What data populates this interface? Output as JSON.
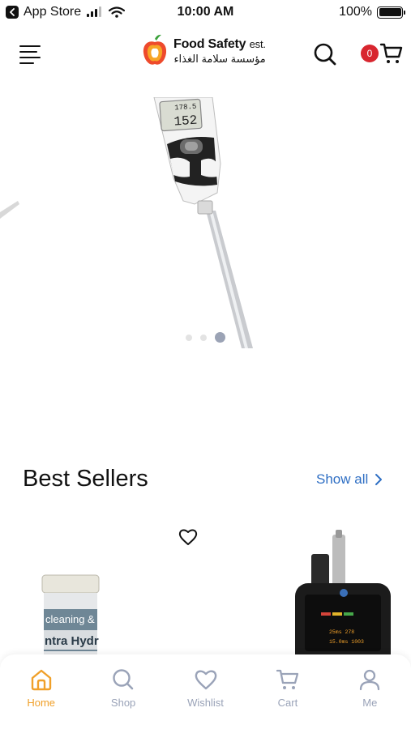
{
  "status_bar": {
    "back_app": "App Store",
    "time": "10:00 AM",
    "battery": "100%"
  },
  "header": {
    "brand_en": "Food Safety",
    "brand_suffix": "est.",
    "brand_ar": "مؤسسة سلامة الغذاء",
    "cart_count": "0"
  },
  "carousel": {
    "slide_count": 3,
    "active_index": 2,
    "thermometer_display_top": "178.5",
    "thermometer_display_main": "152",
    "thermometer_display_unit": "°C"
  },
  "best_sellers": {
    "title": "Best Sellers",
    "show_all_label": "Show all",
    "products": [
      {
        "label_line1": "cleaning &",
        "label_line2": "ntra Hydr"
      },
      {
        "screen_text_1": "25ms 278",
        "screen_text_2": "15.0ms 1003"
      }
    ]
  },
  "bottom_nav": {
    "items": [
      {
        "label": "Home",
        "icon": "home-icon",
        "active": true
      },
      {
        "label": "Shop",
        "icon": "search-icon",
        "active": false
      },
      {
        "label": "Wishlist",
        "icon": "heart-icon",
        "active": false
      },
      {
        "label": "Cart",
        "icon": "cart-icon",
        "active": false
      },
      {
        "label": "Me",
        "icon": "user-icon",
        "active": false
      }
    ]
  },
  "colors": {
    "accent": "#f0a02a",
    "link": "#2f6fc4",
    "badge": "#d8262f",
    "inactive": "#9aa3b8"
  }
}
